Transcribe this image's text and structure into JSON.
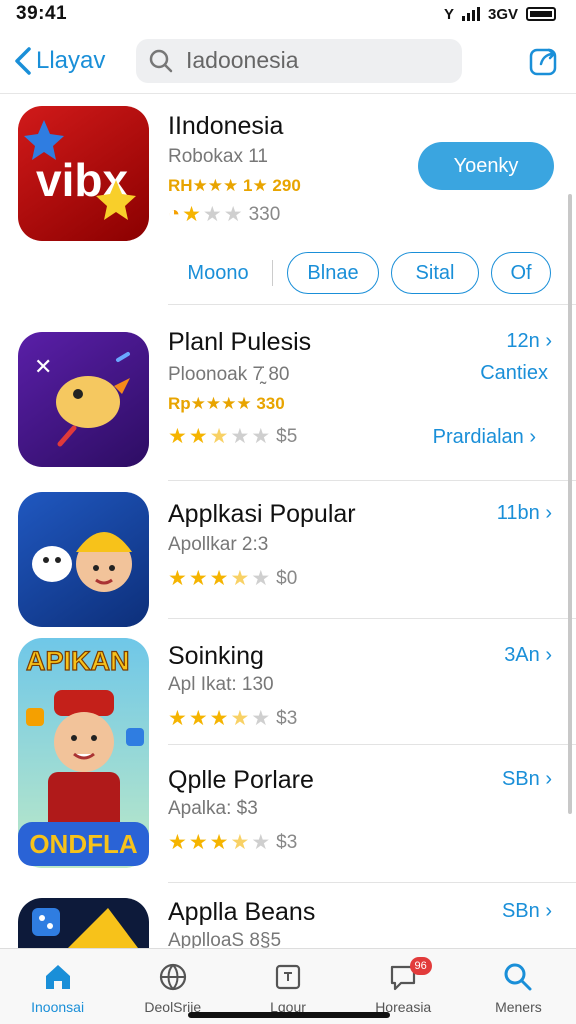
{
  "status": {
    "time": "39:41",
    "carrier": "Y",
    "network": "3GV"
  },
  "nav": {
    "back_label": "Llayav",
    "search_value": "Iadoonesia"
  },
  "featured": {
    "title": "IIndonesia",
    "subtitle": "Robokax 11",
    "rank": "RH★★★ 1★ 290",
    "rating": "330",
    "stars": 1,
    "get_label": "Yoenky",
    "chips": [
      "Moono",
      "Blnae",
      "Sital",
      "Of"
    ],
    "icon_text": "vibx",
    "icon_name": "vibx-star-icon"
  },
  "apps": [
    {
      "title": "Planl Pulesis",
      "subtitle": "Ploonoak 7̰̇ 80",
      "rank": "Rp★★★★ 330",
      "stars": 2.5,
      "rating": "$5",
      "size": "12n ›",
      "link": "Cantiex",
      "link2": "Prardialan ›",
      "icon_name": "cartoon-bird-icon"
    },
    {
      "title": "Applkasi Popular",
      "subtitle": "Apollkar 2:3",
      "stars": 3.5,
      "rating": "$0",
      "size": "11bn ›",
      "icon_name": "cartoon-characters-icon"
    },
    {
      "title": "Soinking",
      "subtitle": "Apl Ikat: 130",
      "stars": 3.5,
      "rating": "$3",
      "size": "3An ›",
      "icon_name": "apikan-game-icon"
    },
    {
      "title": "Qplle Porlare",
      "subtitle": "Apalka: $3",
      "stars": 3.5,
      "rating": "$3",
      "size": "SBn ›",
      "icon_text": "ONDFLA"
    },
    {
      "title": "Applla Beans",
      "subtitle": "ApplloaS 8§5",
      "size": "SBn ›",
      "icon_name": "dark-game-icon"
    }
  ],
  "big_icon_text": "APIKAN",
  "tabs": [
    {
      "label": "Inoonsai",
      "icon": "home-icon",
      "active": true
    },
    {
      "label": "DeolSriie",
      "icon": "globe-icon",
      "active": false
    },
    {
      "label": "Lqour",
      "icon": "square-icon",
      "active": false
    },
    {
      "label": "Horeasia",
      "icon": "chat-icon",
      "active": false,
      "badge": "96"
    },
    {
      "label": "Meners",
      "icon": "search-icon",
      "active": false
    }
  ],
  "colors": {
    "accent": "#1a8fd8",
    "star": "#f5b400",
    "rank": "#e8a400",
    "button": "#3aa5e0"
  }
}
